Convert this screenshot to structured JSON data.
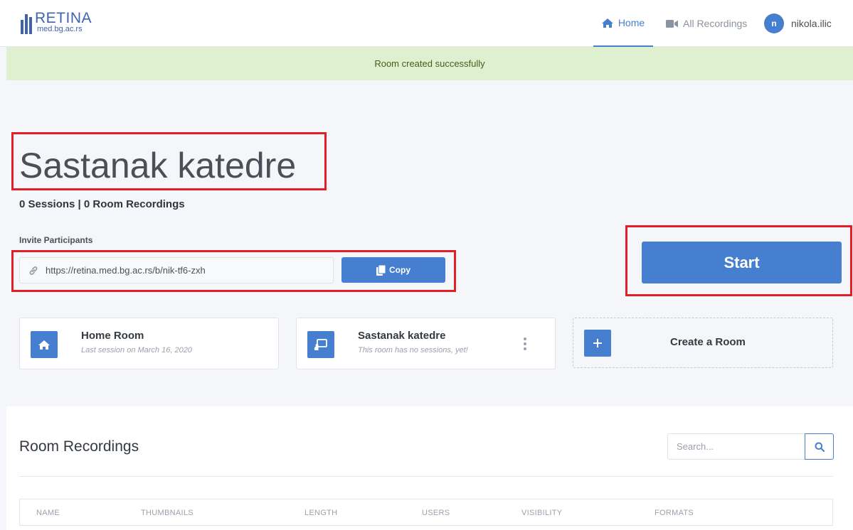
{
  "logo": {
    "title": "RETINA",
    "subtitle": "med.bg.ac.rs"
  },
  "nav": {
    "home_label": "Home",
    "recordings_label": "All Recordings",
    "user_initial": "n",
    "username": "nikola.ilic"
  },
  "alert": {
    "message": "Room created successfully"
  },
  "room": {
    "title": "Sastanak katedre",
    "stats": "0 Sessions | 0 Room Recordings",
    "invite_label": "Invite Participants",
    "invite_url": "https://retina.med.bg.ac.rs/b/nik-tf6-zxh",
    "copy_label": "Copy",
    "start_label": "Start"
  },
  "rooms": [
    {
      "title": "Home Room",
      "subtitle": "Last session on March 16, 2020",
      "icon": "home-icon"
    },
    {
      "title": "Sastanak katedre",
      "subtitle": "This room has no sessions, yet!",
      "icon": "presentation-icon"
    }
  ],
  "create_room_label": "Create a Room",
  "recordings": {
    "title": "Room Recordings",
    "search_placeholder": "Search...",
    "columns": [
      "Name",
      "Thumbnails",
      "Length",
      "Users",
      "Visibility",
      "Formats"
    ]
  },
  "colors": {
    "accent": "#467fcf",
    "alert_bg": "#dff0d0",
    "annotation": "#e21f26"
  }
}
